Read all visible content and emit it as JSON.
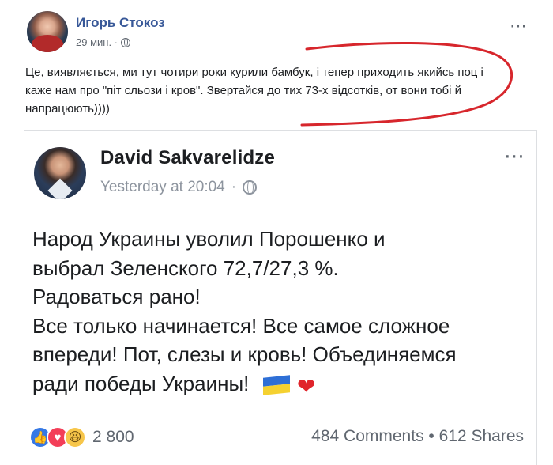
{
  "outer_post": {
    "author": "Игорь Стокоз",
    "time": "29 мин. ·",
    "text": "Це, виявляється, ми тут чотири роки курили бамбук, і тепер приходить якийсь поц і каже нам про \"піт сльози і кров\". Звертайся до тих 73-х відсотків, от вони тобі й напрацюють))))",
    "more_icon": "⋯",
    "annotation_color": "#d7262c"
  },
  "shared_post": {
    "author": "David Sakvarelidze",
    "time": "Yesterday at 20:04",
    "separator": "·",
    "more_icon": "⋯",
    "text_lines": [
      "Народ Украины уволил Порошенко и",
      "выбрал Зеленского 72,7/27,3 %.",
      "Радоваться рано!",
      "Все только начинается! Все самое сложное",
      "впереди! Пот, слезы и кровь! Объединяемся",
      "ради победы Украины!"
    ],
    "emojis": [
      "ukraine-flag",
      "red-heart"
    ],
    "heart_glyph": "❤",
    "reactions": {
      "icons": [
        "like-icon",
        "love-icon",
        "haha-icon"
      ],
      "like_glyph": "👍",
      "love_glyph": "♥",
      "haha_glyph": "😆",
      "count": "2 800"
    },
    "engagement": "484 Comments • 612 Shares"
  }
}
